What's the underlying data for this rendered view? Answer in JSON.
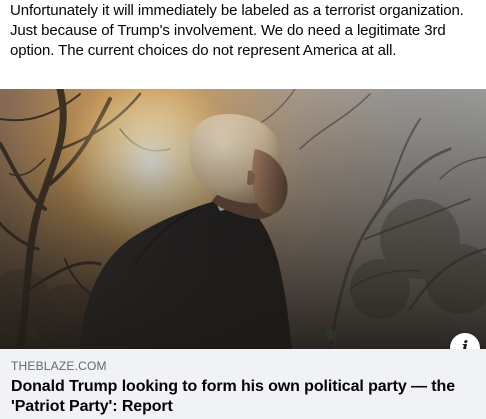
{
  "post": {
    "text": "Unfortunately it will immediately  be labeled as a terrorist organization. Just because of Trump's involvement. We do need a legitimate 3rd option. The current choices do not represent America at all."
  },
  "link_preview": {
    "image_icon": "photo-of-man-in-dark-coat-against-sunset",
    "info_icon": "info-icon",
    "source": "THEBLAZE.COM",
    "headline": "Donald Trump looking to form his own political party — the 'Patriot Party': Report"
  },
  "colors": {
    "footer_bg": "#f0f2f5",
    "source_text": "#65676b",
    "headline_text": "#050505"
  }
}
